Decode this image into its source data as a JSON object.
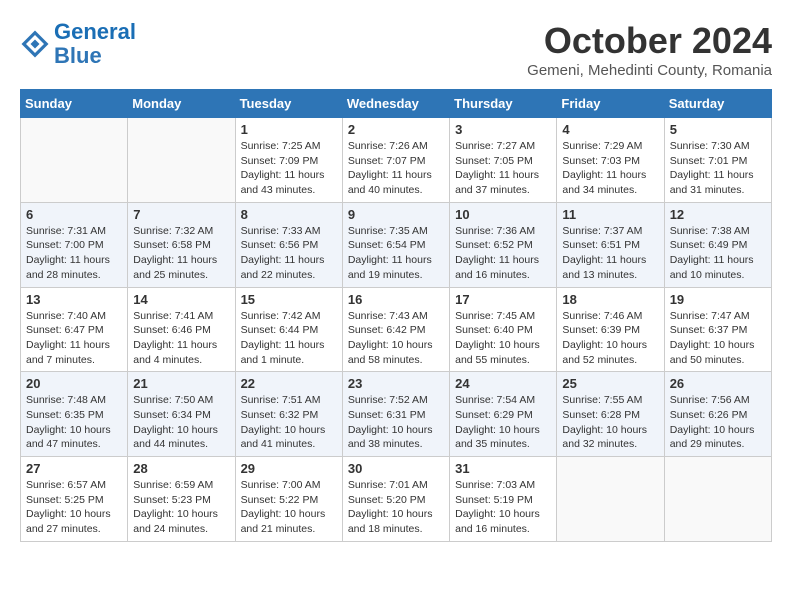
{
  "header": {
    "logo_line1": "General",
    "logo_line2": "Blue",
    "month": "October 2024",
    "location": "Gemeni, Mehedinti County, Romania"
  },
  "weekdays": [
    "Sunday",
    "Monday",
    "Tuesday",
    "Wednesday",
    "Thursday",
    "Friday",
    "Saturday"
  ],
  "weeks": [
    [
      {
        "day": "",
        "info": ""
      },
      {
        "day": "",
        "info": ""
      },
      {
        "day": "1",
        "info": "Sunrise: 7:25 AM\nSunset: 7:09 PM\nDaylight: 11 hours and 43 minutes."
      },
      {
        "day": "2",
        "info": "Sunrise: 7:26 AM\nSunset: 7:07 PM\nDaylight: 11 hours and 40 minutes."
      },
      {
        "day": "3",
        "info": "Sunrise: 7:27 AM\nSunset: 7:05 PM\nDaylight: 11 hours and 37 minutes."
      },
      {
        "day": "4",
        "info": "Sunrise: 7:29 AM\nSunset: 7:03 PM\nDaylight: 11 hours and 34 minutes."
      },
      {
        "day": "5",
        "info": "Sunrise: 7:30 AM\nSunset: 7:01 PM\nDaylight: 11 hours and 31 minutes."
      }
    ],
    [
      {
        "day": "6",
        "info": "Sunrise: 7:31 AM\nSunset: 7:00 PM\nDaylight: 11 hours and 28 minutes."
      },
      {
        "day": "7",
        "info": "Sunrise: 7:32 AM\nSunset: 6:58 PM\nDaylight: 11 hours and 25 minutes."
      },
      {
        "day": "8",
        "info": "Sunrise: 7:33 AM\nSunset: 6:56 PM\nDaylight: 11 hours and 22 minutes."
      },
      {
        "day": "9",
        "info": "Sunrise: 7:35 AM\nSunset: 6:54 PM\nDaylight: 11 hours and 19 minutes."
      },
      {
        "day": "10",
        "info": "Sunrise: 7:36 AM\nSunset: 6:52 PM\nDaylight: 11 hours and 16 minutes."
      },
      {
        "day": "11",
        "info": "Sunrise: 7:37 AM\nSunset: 6:51 PM\nDaylight: 11 hours and 13 minutes."
      },
      {
        "day": "12",
        "info": "Sunrise: 7:38 AM\nSunset: 6:49 PM\nDaylight: 11 hours and 10 minutes."
      }
    ],
    [
      {
        "day": "13",
        "info": "Sunrise: 7:40 AM\nSunset: 6:47 PM\nDaylight: 11 hours and 7 minutes."
      },
      {
        "day": "14",
        "info": "Sunrise: 7:41 AM\nSunset: 6:46 PM\nDaylight: 11 hours and 4 minutes."
      },
      {
        "day": "15",
        "info": "Sunrise: 7:42 AM\nSunset: 6:44 PM\nDaylight: 11 hours and 1 minute."
      },
      {
        "day": "16",
        "info": "Sunrise: 7:43 AM\nSunset: 6:42 PM\nDaylight: 10 hours and 58 minutes."
      },
      {
        "day": "17",
        "info": "Sunrise: 7:45 AM\nSunset: 6:40 PM\nDaylight: 10 hours and 55 minutes."
      },
      {
        "day": "18",
        "info": "Sunrise: 7:46 AM\nSunset: 6:39 PM\nDaylight: 10 hours and 52 minutes."
      },
      {
        "day": "19",
        "info": "Sunrise: 7:47 AM\nSunset: 6:37 PM\nDaylight: 10 hours and 50 minutes."
      }
    ],
    [
      {
        "day": "20",
        "info": "Sunrise: 7:48 AM\nSunset: 6:35 PM\nDaylight: 10 hours and 47 minutes."
      },
      {
        "day": "21",
        "info": "Sunrise: 7:50 AM\nSunset: 6:34 PM\nDaylight: 10 hours and 44 minutes."
      },
      {
        "day": "22",
        "info": "Sunrise: 7:51 AM\nSunset: 6:32 PM\nDaylight: 10 hours and 41 minutes."
      },
      {
        "day": "23",
        "info": "Sunrise: 7:52 AM\nSunset: 6:31 PM\nDaylight: 10 hours and 38 minutes."
      },
      {
        "day": "24",
        "info": "Sunrise: 7:54 AM\nSunset: 6:29 PM\nDaylight: 10 hours and 35 minutes."
      },
      {
        "day": "25",
        "info": "Sunrise: 7:55 AM\nSunset: 6:28 PM\nDaylight: 10 hours and 32 minutes."
      },
      {
        "day": "26",
        "info": "Sunrise: 7:56 AM\nSunset: 6:26 PM\nDaylight: 10 hours and 29 minutes."
      }
    ],
    [
      {
        "day": "27",
        "info": "Sunrise: 6:57 AM\nSunset: 5:25 PM\nDaylight: 10 hours and 27 minutes."
      },
      {
        "day": "28",
        "info": "Sunrise: 6:59 AM\nSunset: 5:23 PM\nDaylight: 10 hours and 24 minutes."
      },
      {
        "day": "29",
        "info": "Sunrise: 7:00 AM\nSunset: 5:22 PM\nDaylight: 10 hours and 21 minutes."
      },
      {
        "day": "30",
        "info": "Sunrise: 7:01 AM\nSunset: 5:20 PM\nDaylight: 10 hours and 18 minutes."
      },
      {
        "day": "31",
        "info": "Sunrise: 7:03 AM\nSunset: 5:19 PM\nDaylight: 10 hours and 16 minutes."
      },
      {
        "day": "",
        "info": ""
      },
      {
        "day": "",
        "info": ""
      }
    ]
  ]
}
